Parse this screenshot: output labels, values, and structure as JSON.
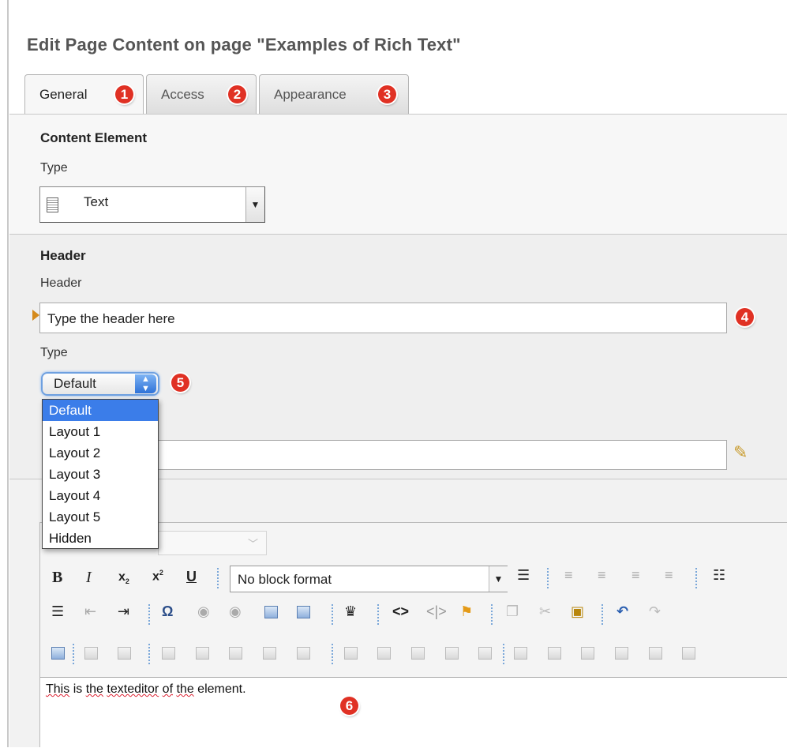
{
  "page": {
    "title": "Edit Page Content on page \"Examples of Rich Text\""
  },
  "tabs": [
    {
      "label": "General",
      "badge": "1",
      "active": true
    },
    {
      "label": "Access",
      "badge": "2",
      "active": false
    },
    {
      "label": "Appearance",
      "badge": "3",
      "active": false
    }
  ],
  "content_element": {
    "section": "Content Element",
    "type_label": "Type",
    "type_value": "Text"
  },
  "header": {
    "section": "Header",
    "header_label": "Header",
    "header_value": "Type the header here",
    "header_badge": "4",
    "type_label": "Type",
    "type_value": "Default",
    "type_badge": "5",
    "type_options": [
      "Default",
      "Layout 1",
      "Layout 2",
      "Layout 3",
      "Layout 4",
      "Layout 5",
      "Hidden"
    ]
  },
  "editor": {
    "block_format": "No block format",
    "text_words": [
      "This",
      "is",
      "the",
      "texteditor",
      "of",
      "the",
      "element."
    ],
    "text_badge": "6"
  },
  "colors": {
    "accent": "#3b7de9",
    "badge": "#e03124",
    "marker": "#d58a1c"
  }
}
